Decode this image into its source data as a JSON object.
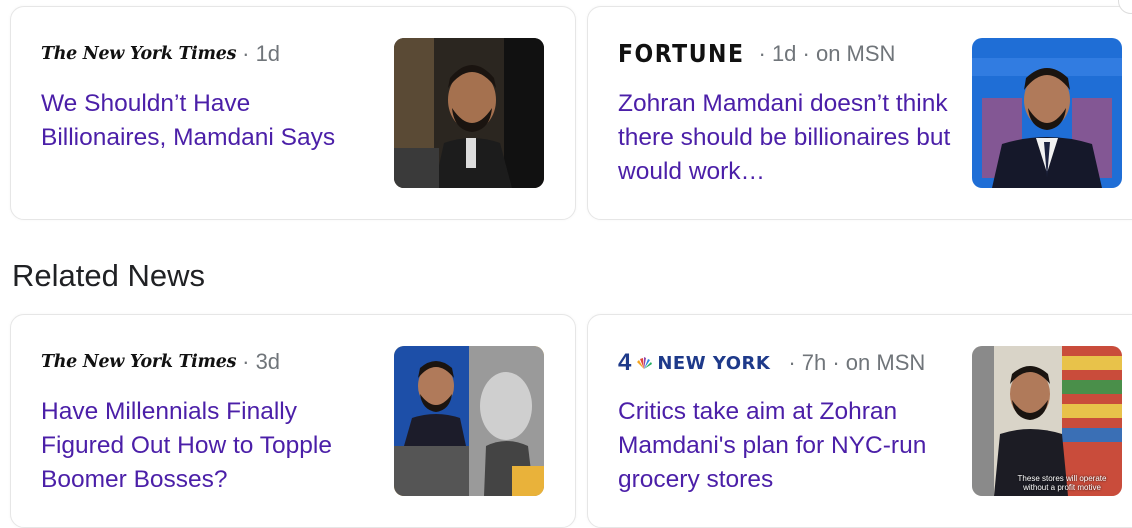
{
  "top_cards": [
    {
      "publisher": "The New York Times",
      "time": "· 1d",
      "headline": "We Shouldn’t Have Billionaires, Mamdani Says"
    },
    {
      "publisher": "FORTUNE",
      "time": "· 1d · on MSN",
      "headline": "Zohran Mamdani doesn’t think there should be billionaires but would work…"
    }
  ],
  "related_news": {
    "title": "Related News",
    "cards": [
      {
        "publisher": "The New York Times",
        "time": "· 3d",
        "headline": "Have Millennials Finally Figured Out How to Topple Boomer Bosses?"
      },
      {
        "publisher_number": "4",
        "publisher": "NEW YORK",
        "time": "· 7h · on MSN",
        "headline": "Critics take aim at Zohran Mamdani's plan for NYC-run grocery stores",
        "thumbnail_caption": "These stores will operate without a profit motive"
      }
    ]
  },
  "colors": {
    "headline": "#4b1fa8",
    "meta": "#70757a",
    "border": "#e6e6e6"
  }
}
